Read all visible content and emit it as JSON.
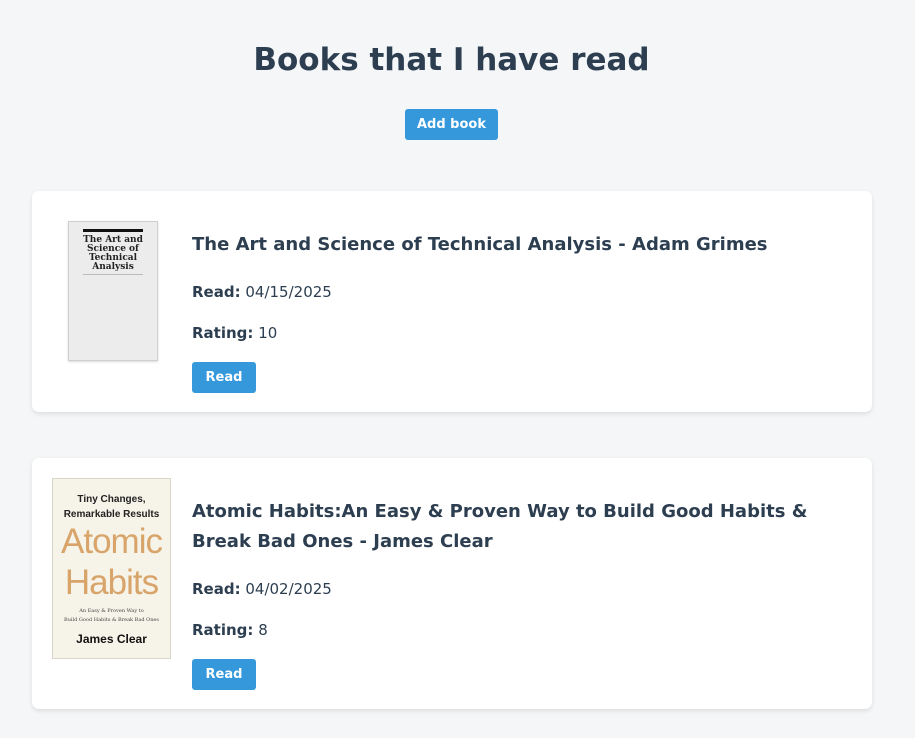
{
  "page": {
    "title": "Books that I have read",
    "add_button": "Add book"
  },
  "colors": {
    "background": "#f4f6f8",
    "text": "#2c3e50",
    "accent": "#3498db",
    "card": "#ffffff"
  },
  "labels": {
    "read": "Read:",
    "rating": "Rating:"
  },
  "books": [
    {
      "title": "The Art and Science of Technical Analysis - Adam Grimes",
      "read_date": "04/15/2025",
      "rating": "10",
      "button": "Read",
      "cover": {
        "text": "The Art and Science of Technical Analysis"
      }
    },
    {
      "title": "Atomic Habits:An Easy & Proven Way to Build Good Habits & Break Bad Ones - James Clear",
      "read_date": "04/02/2025",
      "rating": "8",
      "button": "Read",
      "cover": {
        "tagline_1": "Tiny Changes,",
        "tagline_2": "Remarkable Results",
        "word_1": "Atomic",
        "word_2": "Habits",
        "subtitle_1": "An Easy & Proven Way to",
        "subtitle_2": "Build Good Habits & Break Bad Ones",
        "author": "James Clear"
      }
    }
  ]
}
